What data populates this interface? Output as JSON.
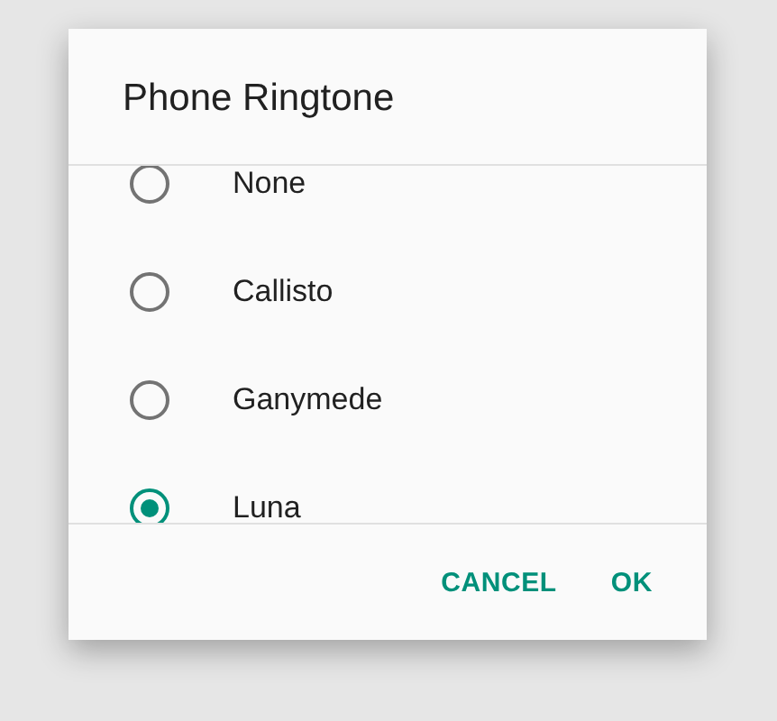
{
  "dialog": {
    "title": "Phone Ringtone",
    "options": [
      {
        "label": "None",
        "selected": false
      },
      {
        "label": "Callisto",
        "selected": false
      },
      {
        "label": "Ganymede",
        "selected": false
      },
      {
        "label": "Luna",
        "selected": true
      }
    ],
    "buttons": [
      "CANCEL",
      "OK"
    ]
  }
}
